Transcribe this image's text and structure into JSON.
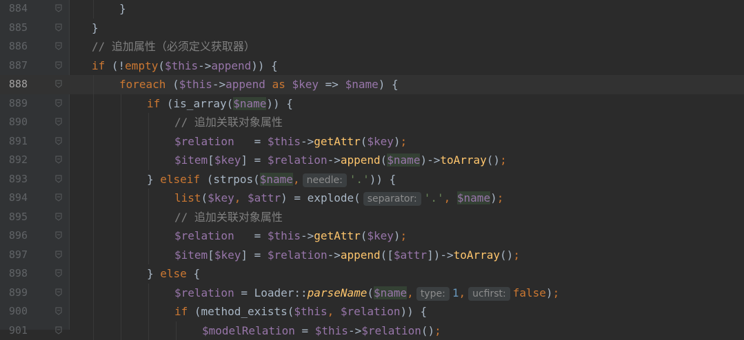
{
  "lines": [
    {
      "n": "884",
      "indent": 4,
      "tokens": [
        {
          "t": "pl",
          "v": "}"
        }
      ]
    },
    {
      "n": "885",
      "indent": 3,
      "tokens": [
        {
          "t": "pl",
          "v": "}"
        }
      ]
    },
    {
      "n": "886",
      "indent": 3,
      "tokens": [
        {
          "t": "cmt",
          "v": "// 追加属性（必须定义获取器）"
        }
      ]
    },
    {
      "n": "887",
      "indent": 3,
      "tokens": [
        {
          "t": "kw",
          "v": "if "
        },
        {
          "t": "pl",
          "v": "(!"
        },
        {
          "t": "kw",
          "v": "empty"
        },
        {
          "t": "pl",
          "v": "("
        },
        {
          "t": "var",
          "v": "$this"
        },
        {
          "t": "pl",
          "v": "->"
        },
        {
          "t": "var",
          "v": "append"
        },
        {
          "t": "pl",
          "v": ")) {"
        }
      ]
    },
    {
      "n": "888",
      "indent": 4,
      "current": true,
      "tokens": [
        {
          "t": "kw",
          "v": "foreach "
        },
        {
          "t": "pl",
          "v": "("
        },
        {
          "t": "var",
          "v": "$this"
        },
        {
          "t": "pl",
          "v": "->"
        },
        {
          "t": "var",
          "v": "append "
        },
        {
          "t": "kw",
          "v": "as "
        },
        {
          "t": "var",
          "v": "$key "
        },
        {
          "t": "pl",
          "v": "=> "
        },
        {
          "t": "var",
          "v": "$name"
        },
        {
          "t": "pl",
          "v": ") {"
        }
      ]
    },
    {
      "n": "889",
      "indent": 5,
      "tokens": [
        {
          "t": "kw",
          "v": "if "
        },
        {
          "t": "pl",
          "v": "(is_array("
        },
        {
          "t": "var-hl",
          "v": "$name"
        },
        {
          "t": "pl",
          "v": ")) {"
        }
      ]
    },
    {
      "n": "890",
      "indent": 6,
      "tokens": [
        {
          "t": "cmt",
          "v": "// 追加关联对象属性"
        }
      ]
    },
    {
      "n": "891",
      "indent": 6,
      "tokens": [
        {
          "t": "var",
          "v": "$relation   "
        },
        {
          "t": "pl",
          "v": "= "
        },
        {
          "t": "var",
          "v": "$this"
        },
        {
          "t": "pl",
          "v": "->"
        },
        {
          "t": "fn",
          "v": "getAttr"
        },
        {
          "t": "pl",
          "v": "("
        },
        {
          "t": "var",
          "v": "$key"
        },
        {
          "t": "pl",
          "v": ")"
        },
        {
          "t": "kw",
          "v": ";"
        }
      ]
    },
    {
      "n": "892",
      "indent": 6,
      "tokens": [
        {
          "t": "var",
          "v": "$item"
        },
        {
          "t": "pl",
          "v": "["
        },
        {
          "t": "var",
          "v": "$key"
        },
        {
          "t": "pl",
          "v": "] = "
        },
        {
          "t": "var",
          "v": "$relation"
        },
        {
          "t": "pl",
          "v": "->"
        },
        {
          "t": "fn",
          "v": "append"
        },
        {
          "t": "pl",
          "v": "("
        },
        {
          "t": "var-hl",
          "v": "$name"
        },
        {
          "t": "pl",
          "v": ")->"
        },
        {
          "t": "fn",
          "v": "toArray"
        },
        {
          "t": "pl",
          "v": "()"
        },
        {
          "t": "kw",
          "v": ";"
        }
      ]
    },
    {
      "n": "893",
      "indent": 5,
      "tokens": [
        {
          "t": "pl",
          "v": "} "
        },
        {
          "t": "kw",
          "v": "elseif "
        },
        {
          "t": "pl",
          "v": "(strpos("
        },
        {
          "t": "var-hl",
          "v": "$name"
        },
        {
          "t": "kw",
          "v": ","
        },
        {
          "t": "hint",
          "v": "needle:"
        },
        {
          "t": "str",
          "v": "'.'"
        },
        {
          "t": "pl",
          "v": ")) {"
        }
      ]
    },
    {
      "n": "894",
      "indent": 6,
      "tokens": [
        {
          "t": "kw",
          "v": "list"
        },
        {
          "t": "pl",
          "v": "("
        },
        {
          "t": "var",
          "v": "$key"
        },
        {
          "t": "kw",
          "v": ", "
        },
        {
          "t": "var",
          "v": "$attr"
        },
        {
          "t": "pl",
          "v": ") = explode("
        },
        {
          "t": "hint",
          "v": "separator:"
        },
        {
          "t": "str",
          "v": "'.'"
        },
        {
          "t": "kw",
          "v": ", "
        },
        {
          "t": "var-hl",
          "v": "$name"
        },
        {
          "t": "pl",
          "v": ")"
        },
        {
          "t": "kw",
          "v": ";"
        }
      ]
    },
    {
      "n": "895",
      "indent": 6,
      "tokens": [
        {
          "t": "cmt",
          "v": "// 追加关联对象属性"
        }
      ]
    },
    {
      "n": "896",
      "indent": 6,
      "tokens": [
        {
          "t": "var",
          "v": "$relation   "
        },
        {
          "t": "pl",
          "v": "= "
        },
        {
          "t": "var",
          "v": "$this"
        },
        {
          "t": "pl",
          "v": "->"
        },
        {
          "t": "fn",
          "v": "getAttr"
        },
        {
          "t": "pl",
          "v": "("
        },
        {
          "t": "var",
          "v": "$key"
        },
        {
          "t": "pl",
          "v": ")"
        },
        {
          "t": "kw",
          "v": ";"
        }
      ]
    },
    {
      "n": "897",
      "indent": 6,
      "tokens": [
        {
          "t": "var",
          "v": "$item"
        },
        {
          "t": "pl",
          "v": "["
        },
        {
          "t": "var",
          "v": "$key"
        },
        {
          "t": "pl",
          "v": "] = "
        },
        {
          "t": "var",
          "v": "$relation"
        },
        {
          "t": "pl",
          "v": "->"
        },
        {
          "t": "fn",
          "v": "append"
        },
        {
          "t": "pl",
          "v": "(["
        },
        {
          "t": "var",
          "v": "$attr"
        },
        {
          "t": "pl",
          "v": "])->"
        },
        {
          "t": "fn",
          "v": "toArray"
        },
        {
          "t": "pl",
          "v": "()"
        },
        {
          "t": "kw",
          "v": ";"
        }
      ]
    },
    {
      "n": "898",
      "indent": 5,
      "tokens": [
        {
          "t": "pl",
          "v": "} "
        },
        {
          "t": "kw",
          "v": "else "
        },
        {
          "t": "pl",
          "v": "{"
        }
      ]
    },
    {
      "n": "899",
      "indent": 6,
      "tokens": [
        {
          "t": "var",
          "v": "$relation "
        },
        {
          "t": "pl",
          "v": "= Loader::"
        },
        {
          "t": "fn-it",
          "v": "parseName"
        },
        {
          "t": "pl",
          "v": "("
        },
        {
          "t": "var-hl",
          "v": "$name"
        },
        {
          "t": "kw",
          "v": ","
        },
        {
          "t": "hint",
          "v": "type:"
        },
        {
          "t": "num",
          "v": "1"
        },
        {
          "t": "kw",
          "v": ","
        },
        {
          "t": "hint",
          "v": "ucfirst:"
        },
        {
          "t": "kw",
          "v": "false"
        },
        {
          "t": "pl",
          "v": ")"
        },
        {
          "t": "kw",
          "v": ";"
        }
      ]
    },
    {
      "n": "900",
      "indent": 6,
      "tokens": [
        {
          "t": "kw",
          "v": "if "
        },
        {
          "t": "pl",
          "v": "(method_exists("
        },
        {
          "t": "var",
          "v": "$this"
        },
        {
          "t": "kw",
          "v": ", "
        },
        {
          "t": "var",
          "v": "$relation"
        },
        {
          "t": "pl",
          "v": ")) {"
        }
      ]
    },
    {
      "n": "901",
      "indent": 7,
      "tokens": [
        {
          "t": "var",
          "v": "$modelRelation "
        },
        {
          "t": "pl",
          "v": "= "
        },
        {
          "t": "var",
          "v": "$this"
        },
        {
          "t": "pl",
          "v": "->"
        },
        {
          "t": "var",
          "v": "$relation"
        },
        {
          "t": "pl",
          "v": "()"
        },
        {
          "t": "kw",
          "v": ";"
        }
      ]
    }
  ],
  "colors": {
    "background": "#2b2b2b",
    "gutter": "#313335",
    "keyword": "#cc7832",
    "variable": "#9876aa",
    "function": "#ffc66d",
    "string": "#6a8759",
    "number": "#6897bb",
    "comment": "#808080",
    "text": "#a9b7c6"
  }
}
